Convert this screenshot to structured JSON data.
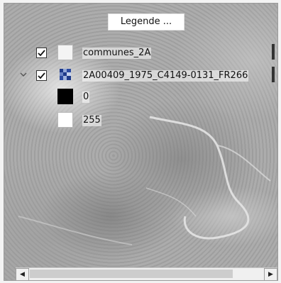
{
  "legend": {
    "title": "Legende ...",
    "layers": [
      {
        "name": "communes_2A",
        "checked": true,
        "icon": "polygon-layer-icon"
      },
      {
        "name": "2A00409_1975_C4149-0131_FR266",
        "checked": true,
        "icon": "raster-layer-icon",
        "expanded": true
      }
    ],
    "raster_legend": [
      {
        "value": "0",
        "color": "#000000"
      },
      {
        "value": "255",
        "color": "#ffffff"
      }
    ]
  },
  "scrollbar": {
    "left_arrow": "◀",
    "right_arrow": "▶"
  },
  "icons": {
    "expand": "chevron-down-icon",
    "check": "checkmark-icon"
  }
}
